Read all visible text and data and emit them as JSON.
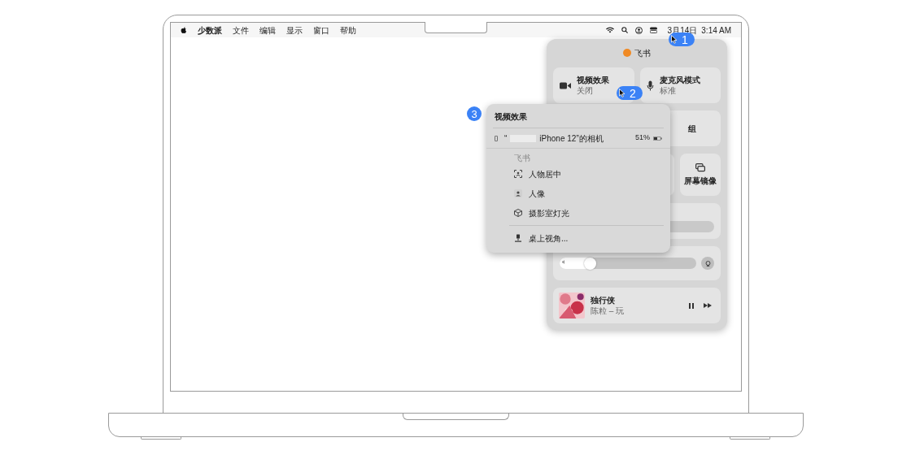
{
  "menubar": {
    "app": "少数派",
    "menus": [
      "文件",
      "编辑",
      "显示",
      "窗口",
      "帮助"
    ],
    "date": "3月14日",
    "time": "3:14 AM"
  },
  "control_center": {
    "app": "飞书",
    "tiles": [
      {
        "title": "视频效果",
        "subtitle": "关闭",
        "kind": "camera"
      },
      {
        "title": "麦克风模式",
        "subtitle": "标准",
        "kind": "mic"
      }
    ],
    "partial_tile_text": "组",
    "mirroring": "屏幕镜像",
    "volume": {
      "level": 0.27
    },
    "now_playing": {
      "title": "独行侠",
      "artist": "陈粒 – 玩"
    }
  },
  "popup": {
    "title": "视频效果",
    "device": {
      "quote": "“",
      "name": "iPhone 12”的相机",
      "battery": "51%"
    },
    "section": "飞书",
    "items": [
      {
        "label": "人物居中",
        "kind": "center"
      },
      {
        "label": "人像",
        "kind": "portrait"
      },
      {
        "label": "摄影室灯光",
        "kind": "light"
      }
    ],
    "footer": "桌上视角..."
  },
  "steps": [
    "1",
    "2",
    "3"
  ]
}
